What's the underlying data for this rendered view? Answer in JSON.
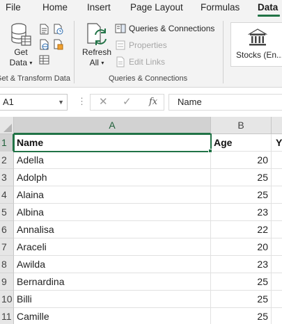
{
  "ribbon_tabs": [
    {
      "label": "File",
      "active": false
    },
    {
      "label": "Home",
      "active": false
    },
    {
      "label": "Insert",
      "active": false
    },
    {
      "label": "Page Layout",
      "active": false
    },
    {
      "label": "Formulas",
      "active": false
    },
    {
      "label": "Data",
      "active": true
    }
  ],
  "groups": {
    "get_transform": {
      "label": "Get & Transform Data",
      "get_data_line1": "Get",
      "get_data_line2": "Data"
    },
    "queries": {
      "label": "Queries & Connections",
      "refresh_line1": "Refresh",
      "refresh_line2": "All",
      "queries_connections": "Queries & Connections",
      "properties": "Properties",
      "edit_links": "Edit Links"
    },
    "data_types": {
      "stocks": "Stocks (En..."
    }
  },
  "formula_bar": {
    "name_box": "A1",
    "fx_symbol": "fx",
    "content": "Name"
  },
  "sheet": {
    "columns": [
      "A",
      "B"
    ],
    "partial_column_c_value": "Y",
    "selected_cell": "A1",
    "rows": [
      {
        "num": "1",
        "name": "Name",
        "age": "Age"
      },
      {
        "num": "2",
        "name": "Adella",
        "age": "20"
      },
      {
        "num": "3",
        "name": "Adolph",
        "age": "25"
      },
      {
        "num": "4",
        "name": "Alaina",
        "age": "25"
      },
      {
        "num": "5",
        "name": "Albina",
        "age": "23"
      },
      {
        "num": "6",
        "name": "Annalisa",
        "age": "22"
      },
      {
        "num": "7",
        "name": "Araceli",
        "age": "20"
      },
      {
        "num": "8",
        "name": "Awilda",
        "age": "23"
      },
      {
        "num": "9",
        "name": "Bernardina",
        "age": "25"
      },
      {
        "num": "10",
        "name": "Billi",
        "age": "25"
      },
      {
        "num": "11",
        "name": "Camille",
        "age": "25"
      }
    ]
  },
  "colors": {
    "accent_green": "#217346",
    "ribbon_bg": "#f3f3f3",
    "header_bg": "#e6e6e6"
  }
}
